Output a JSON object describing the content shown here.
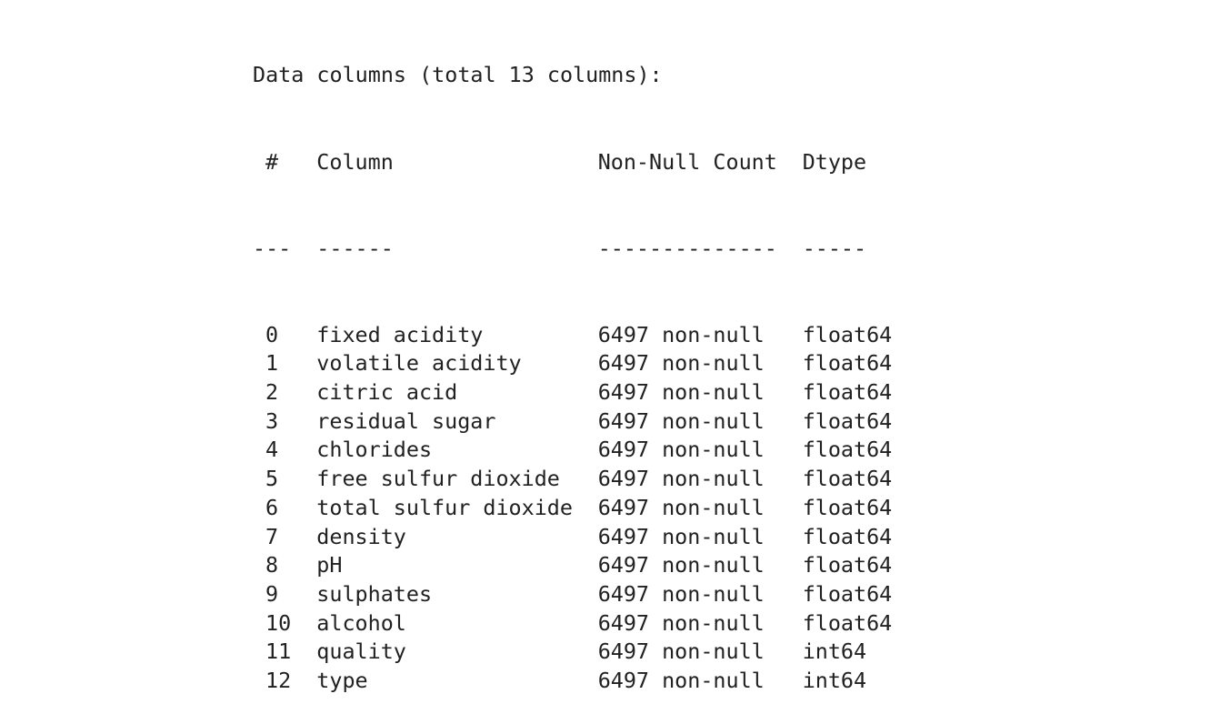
{
  "output": {
    "summary_line": "Data columns (total 13 columns):",
    "header": {
      "index": "#",
      "column": "Column",
      "count": "Non-Null Count",
      "dtype": "Dtype"
    },
    "separator": {
      "index": "---",
      "column": "------",
      "count": "--------------",
      "dtype": "-----"
    },
    "rows": [
      {
        "index": "0",
        "column": "fixed acidity",
        "count": "6497 non-null",
        "dtype": "float64"
      },
      {
        "index": "1",
        "column": "volatile acidity",
        "count": "6497 non-null",
        "dtype": "float64"
      },
      {
        "index": "2",
        "column": "citric acid",
        "count": "6497 non-null",
        "dtype": "float64"
      },
      {
        "index": "3",
        "column": "residual sugar",
        "count": "6497 non-null",
        "dtype": "float64"
      },
      {
        "index": "4",
        "column": "chlorides",
        "count": "6497 non-null",
        "dtype": "float64"
      },
      {
        "index": "5",
        "column": "free sulfur dioxide",
        "count": "6497 non-null",
        "dtype": "float64"
      },
      {
        "index": "6",
        "column": "total sulfur dioxide",
        "count": "6497 non-null",
        "dtype": "float64"
      },
      {
        "index": "7",
        "column": "density",
        "count": "6497 non-null",
        "dtype": "float64"
      },
      {
        "index": "8",
        "column": "pH",
        "count": "6497 non-null",
        "dtype": "float64"
      },
      {
        "index": "9",
        "column": "sulphates",
        "count": "6497 non-null",
        "dtype": "float64"
      },
      {
        "index": "10",
        "column": "alcohol",
        "count": "6497 non-null",
        "dtype": "float64"
      },
      {
        "index": "11",
        "column": "quality",
        "count": "6497 non-null",
        "dtype": "int64"
      },
      {
        "index": "12",
        "column": "type",
        "count": "6497 non-null",
        "dtype": "int64"
      }
    ]
  }
}
